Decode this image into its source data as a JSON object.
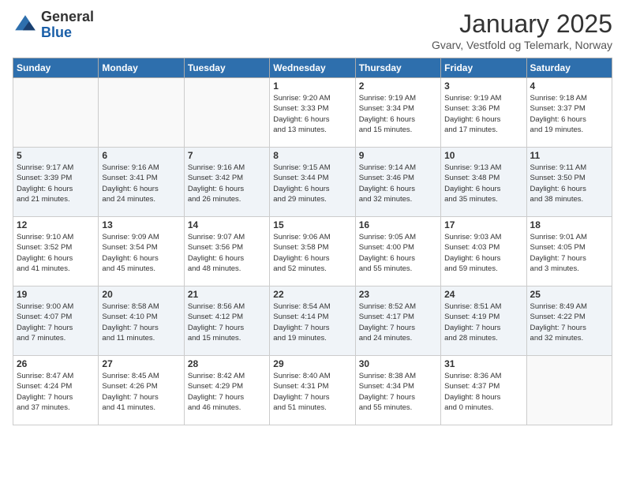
{
  "logo": {
    "general": "General",
    "blue": "Blue"
  },
  "header": {
    "title": "January 2025",
    "location": "Gvarv, Vestfold og Telemark, Norway"
  },
  "weekdays": [
    "Sunday",
    "Monday",
    "Tuesday",
    "Wednesday",
    "Thursday",
    "Friday",
    "Saturday"
  ],
  "weeks": [
    [
      {
        "day": "",
        "info": ""
      },
      {
        "day": "",
        "info": ""
      },
      {
        "day": "",
        "info": ""
      },
      {
        "day": "1",
        "info": "Sunrise: 9:20 AM\nSunset: 3:33 PM\nDaylight: 6 hours\nand 13 minutes."
      },
      {
        "day": "2",
        "info": "Sunrise: 9:19 AM\nSunset: 3:34 PM\nDaylight: 6 hours\nand 15 minutes."
      },
      {
        "day": "3",
        "info": "Sunrise: 9:19 AM\nSunset: 3:36 PM\nDaylight: 6 hours\nand 17 minutes."
      },
      {
        "day": "4",
        "info": "Sunrise: 9:18 AM\nSunset: 3:37 PM\nDaylight: 6 hours\nand 19 minutes."
      }
    ],
    [
      {
        "day": "5",
        "info": "Sunrise: 9:17 AM\nSunset: 3:39 PM\nDaylight: 6 hours\nand 21 minutes."
      },
      {
        "day": "6",
        "info": "Sunrise: 9:16 AM\nSunset: 3:41 PM\nDaylight: 6 hours\nand 24 minutes."
      },
      {
        "day": "7",
        "info": "Sunrise: 9:16 AM\nSunset: 3:42 PM\nDaylight: 6 hours\nand 26 minutes."
      },
      {
        "day": "8",
        "info": "Sunrise: 9:15 AM\nSunset: 3:44 PM\nDaylight: 6 hours\nand 29 minutes."
      },
      {
        "day": "9",
        "info": "Sunrise: 9:14 AM\nSunset: 3:46 PM\nDaylight: 6 hours\nand 32 minutes."
      },
      {
        "day": "10",
        "info": "Sunrise: 9:13 AM\nSunset: 3:48 PM\nDaylight: 6 hours\nand 35 minutes."
      },
      {
        "day": "11",
        "info": "Sunrise: 9:11 AM\nSunset: 3:50 PM\nDaylight: 6 hours\nand 38 minutes."
      }
    ],
    [
      {
        "day": "12",
        "info": "Sunrise: 9:10 AM\nSunset: 3:52 PM\nDaylight: 6 hours\nand 41 minutes."
      },
      {
        "day": "13",
        "info": "Sunrise: 9:09 AM\nSunset: 3:54 PM\nDaylight: 6 hours\nand 45 minutes."
      },
      {
        "day": "14",
        "info": "Sunrise: 9:07 AM\nSunset: 3:56 PM\nDaylight: 6 hours\nand 48 minutes."
      },
      {
        "day": "15",
        "info": "Sunrise: 9:06 AM\nSunset: 3:58 PM\nDaylight: 6 hours\nand 52 minutes."
      },
      {
        "day": "16",
        "info": "Sunrise: 9:05 AM\nSunset: 4:00 PM\nDaylight: 6 hours\nand 55 minutes."
      },
      {
        "day": "17",
        "info": "Sunrise: 9:03 AM\nSunset: 4:03 PM\nDaylight: 6 hours\nand 59 minutes."
      },
      {
        "day": "18",
        "info": "Sunrise: 9:01 AM\nSunset: 4:05 PM\nDaylight: 7 hours\nand 3 minutes."
      }
    ],
    [
      {
        "day": "19",
        "info": "Sunrise: 9:00 AM\nSunset: 4:07 PM\nDaylight: 7 hours\nand 7 minutes."
      },
      {
        "day": "20",
        "info": "Sunrise: 8:58 AM\nSunset: 4:10 PM\nDaylight: 7 hours\nand 11 minutes."
      },
      {
        "day": "21",
        "info": "Sunrise: 8:56 AM\nSunset: 4:12 PM\nDaylight: 7 hours\nand 15 minutes."
      },
      {
        "day": "22",
        "info": "Sunrise: 8:54 AM\nSunset: 4:14 PM\nDaylight: 7 hours\nand 19 minutes."
      },
      {
        "day": "23",
        "info": "Sunrise: 8:52 AM\nSunset: 4:17 PM\nDaylight: 7 hours\nand 24 minutes."
      },
      {
        "day": "24",
        "info": "Sunrise: 8:51 AM\nSunset: 4:19 PM\nDaylight: 7 hours\nand 28 minutes."
      },
      {
        "day": "25",
        "info": "Sunrise: 8:49 AM\nSunset: 4:22 PM\nDaylight: 7 hours\nand 32 minutes."
      }
    ],
    [
      {
        "day": "26",
        "info": "Sunrise: 8:47 AM\nSunset: 4:24 PM\nDaylight: 7 hours\nand 37 minutes."
      },
      {
        "day": "27",
        "info": "Sunrise: 8:45 AM\nSunset: 4:26 PM\nDaylight: 7 hours\nand 41 minutes."
      },
      {
        "day": "28",
        "info": "Sunrise: 8:42 AM\nSunset: 4:29 PM\nDaylight: 7 hours\nand 46 minutes."
      },
      {
        "day": "29",
        "info": "Sunrise: 8:40 AM\nSunset: 4:31 PM\nDaylight: 7 hours\nand 51 minutes."
      },
      {
        "day": "30",
        "info": "Sunrise: 8:38 AM\nSunset: 4:34 PM\nDaylight: 7 hours\nand 55 minutes."
      },
      {
        "day": "31",
        "info": "Sunrise: 8:36 AM\nSunset: 4:37 PM\nDaylight: 8 hours\nand 0 minutes."
      },
      {
        "day": "",
        "info": ""
      }
    ]
  ]
}
